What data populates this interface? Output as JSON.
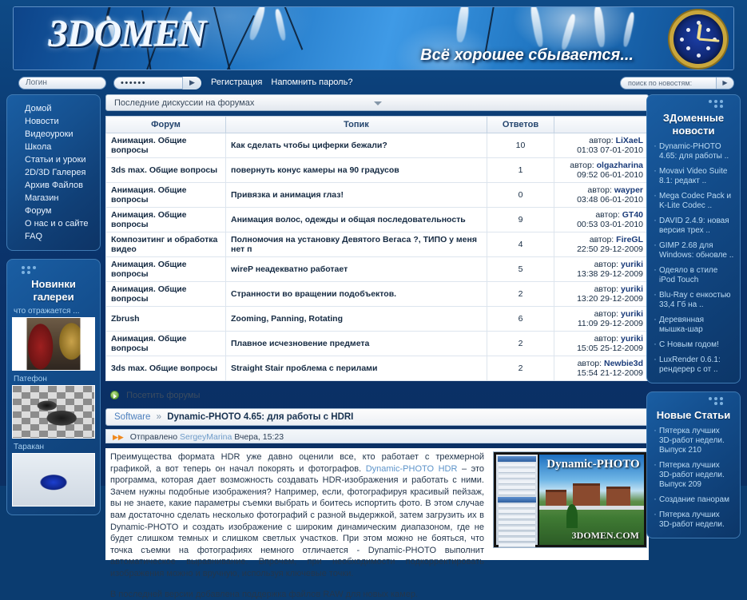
{
  "banner": {
    "logo": "3DOMEN",
    "tagline": "Всё хорошее сбывается...",
    "clock_icon": "wristwatch-icon"
  },
  "loginbar": {
    "login_placeholder": "Логин",
    "password_value": "••••••",
    "submit_icon": "▶",
    "register_label": "Регистрация",
    "remind_label": "Напомнить пароль?",
    "search_placeholder": "поиск по новостям:",
    "search_icon": "▶"
  },
  "sidebar_left": {
    "nav": [
      {
        "label": "Домой"
      },
      {
        "label": "Новости"
      },
      {
        "label": "Видеоуроки"
      },
      {
        "label": "Школа"
      },
      {
        "label": "Статьи и уроки"
      },
      {
        "label": "2D/3D Галерея"
      },
      {
        "label": "Архив Файлов"
      },
      {
        "label": "Магазин"
      },
      {
        "label": "Форум"
      },
      {
        "label": "О нас и о сайте"
      },
      {
        "label": "FAQ"
      }
    ],
    "gallery": {
      "title_line1": "Новинки",
      "title_line2": "галереи",
      "items": [
        {
          "caption": "что отражается ..."
        },
        {
          "caption": "Патефон"
        },
        {
          "caption": "Таракан"
        }
      ]
    }
  },
  "center": {
    "dropdown_label": "Последние дискуссии на форумах",
    "table": {
      "headers": [
        "Форум",
        "Топик",
        "Ответов",
        ""
      ],
      "rows": [
        {
          "forum": "Анимация. Общие вопросы",
          "topic": "Как сделать чтобы циферки бежали?",
          "answers": "10",
          "author_prefix": "автор:",
          "author": "LiXaeL",
          "date": "01:03 07-01-2010"
        },
        {
          "forum": "3ds max. Общие вопросы",
          "topic": "повернуть конус камеры на 90 градусов",
          "answers": "1",
          "author_prefix": "автор:",
          "author": "olgazharina",
          "date": "09:52 06-01-2010"
        },
        {
          "forum": "Анимация. Общие вопросы",
          "topic": "Привязка и анимация глаз!",
          "answers": "0",
          "author_prefix": "автор:",
          "author": "wayper",
          "date": "03:48 06-01-2010"
        },
        {
          "forum": "Анимация. Общие вопросы",
          "topic": "Анимация волос, одежды и общая последовательность",
          "answers": "9",
          "author_prefix": "автор:",
          "author": "GT40",
          "date": "00:53 03-01-2010"
        },
        {
          "forum": "Композитинг и обработка видео",
          "topic": "Полномочия на установку Девятого Вегаса ?, ТИПО у меня нет п",
          "answers": "4",
          "author_prefix": "автор:",
          "author": "FireGL",
          "date": "22:50 29-12-2009"
        },
        {
          "forum": "Анимация. Общие вопросы",
          "topic": "wireP неадекватно работает",
          "answers": "5",
          "author_prefix": "автор:",
          "author": "yuriki",
          "date": "13:38 29-12-2009"
        },
        {
          "forum": "Анимация. Общие вопросы",
          "topic": "Странности во вращении подобъектов.",
          "answers": "2",
          "author_prefix": "автор:",
          "author": "yuriki",
          "date": "13:20 29-12-2009"
        },
        {
          "forum": "Zbrush",
          "topic": "Zooming, Panning, Rotating",
          "answers": "6",
          "author_prefix": "автор:",
          "author": "yuriki",
          "date": "11:09 29-12-2009"
        },
        {
          "forum": "Анимация. Общие вопросы",
          "topic": "Плавное исчезновение предмета",
          "answers": "2",
          "author_prefix": "автор:",
          "author": "yuriki",
          "date": "15:05 25-12-2009"
        },
        {
          "forum": "3ds max. Общие вопросы",
          "topic": "Straight Stair проблема с перилами",
          "answers": "2",
          "author_prefix": "автор:",
          "author": "Newbie3d",
          "date": "15:54 21-12-2009"
        }
      ]
    },
    "visit_forums_label": "Посетить форумы",
    "breadcrumb": {
      "section": "Software",
      "separator": "»",
      "title": "Dynamic-PHOTO 4.65: для работы с HDRI"
    },
    "post_meta": {
      "prefix": "Отправлено",
      "author": "SergeyMarina",
      "date": "Вчера, 15:23"
    },
    "article": {
      "para1_a": "Преимущества формата HDR уже давно оценили все, кто работает с трехмерной графикой, а вот теперь он начал покорять и фотографов. ",
      "para1_link": "Dynamic-PHOTO HDR",
      "para1_b": " – это программа, которая дает возможность создавать HDR-изображения и работать с ними. Зачем нужны подобные изображения? Например, если, фотографируя красивый пейзаж, вы не знаете, какие параметры съемки выбрать и боитесь испортить фото. В этом случае вам достаточно сделать несколько фотографий с разной выдержкой, затем загрузить их в Dynamic-PHOTO и создать изображение с широким динамическим диапазоном, где не будет слишком темных и слишком светлых участков. При этом можно не бояться, что точка съемки на фотографиях немного отличается - Dynamic-PHOTO выполнит автоматическое выравнивание. Впрочем, при необходимости подкорректировать изображения можно и вручную, используя ключевые точки.",
      "para2": "В последней версии добавлена поддержка файлов RAW для новых камер.",
      "screenshot_title": "Dynamic-PHOTO",
      "screenshot_watermark": "3DOMEN.COM"
    }
  },
  "sidebar_right": {
    "news": {
      "title_line1": "ЗДоменные",
      "title_line2": "новости",
      "items": [
        {
          "label": "Dynamic-PHOTO 4.65: для работы .."
        },
        {
          "label": "Movavi Video Suite 8.1: редакт .."
        },
        {
          "label": "Mega Codec Pack и K-Lite Codec .."
        },
        {
          "label": "DAVID 2.4.9: новая версия трех .."
        },
        {
          "label": "GIMP 2.68 для Windows: обновле .."
        },
        {
          "label": "Одеяло в стиле iPod Touch"
        },
        {
          "label": "Blu-Ray с енкостью 33,4 Гб на .."
        },
        {
          "label": "Деревянная мышка-шар"
        },
        {
          "label": "С Новым годом!"
        },
        {
          "label": "LuxRender 0.6.1: рендерер с от .."
        }
      ]
    },
    "articles": {
      "title": "Новые Статьи",
      "items": [
        {
          "label": "Пятерка лучших 3D-работ недели. Выпуск 210"
        },
        {
          "label": "Пятерка лучших 3D-работ недели. Выпуск 209"
        },
        {
          "label": "Создание панорам"
        },
        {
          "label": "Пятерка лучших 3D-работ недели."
        }
      ]
    }
  },
  "colors": {
    "page_blue": "#0b3c70",
    "panel_blue": "#134d8c",
    "accent_link": "#1d4fa8",
    "soft_link": "#5c93c9",
    "header_text": "#24456e"
  }
}
